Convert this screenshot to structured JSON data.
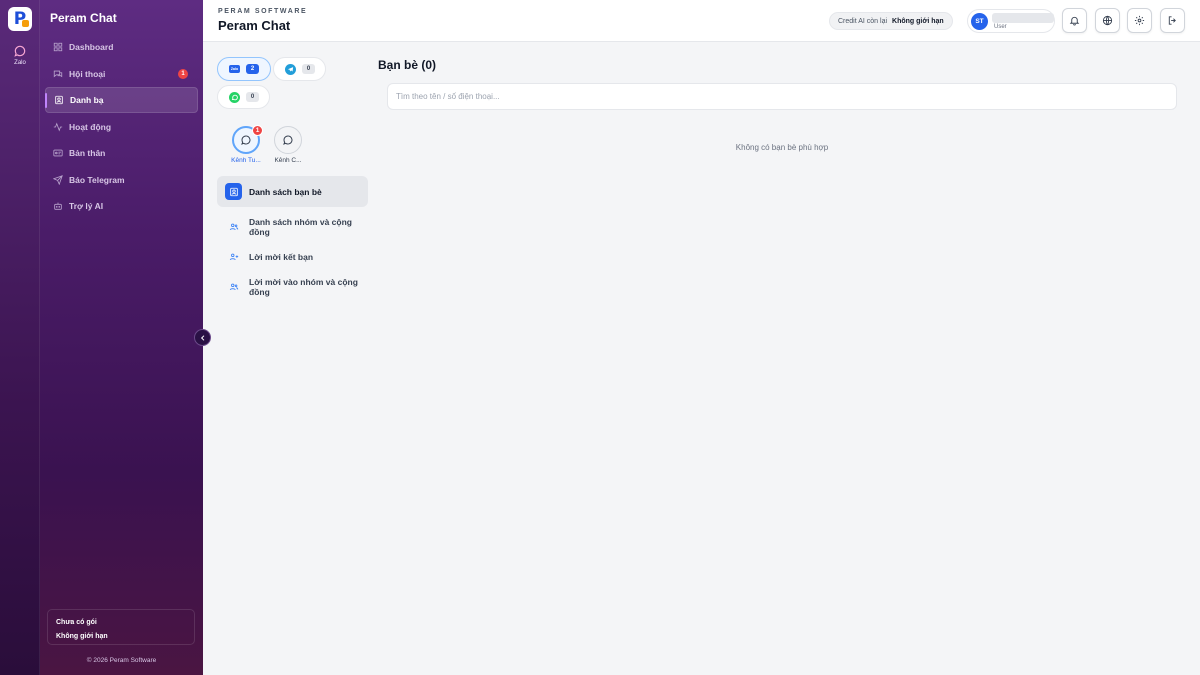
{
  "rail": {
    "logo_letter": "P",
    "items": [
      {
        "label": "Zalo",
        "icon": "chat-bubble-icon"
      }
    ]
  },
  "sidebar": {
    "brand": "Peram Chat",
    "nav": [
      {
        "label": "Dashboard",
        "icon": "grid-icon",
        "active": false
      },
      {
        "label": "Hội thoại",
        "icon": "chat-icon",
        "active": false,
        "badge": "1"
      },
      {
        "label": "Danh bạ",
        "icon": "contacts-icon",
        "active": true
      },
      {
        "label": "Hoạt động",
        "icon": "activity-icon",
        "active": false
      },
      {
        "label": "Bản thân",
        "icon": "id-card-icon",
        "active": false
      },
      {
        "label": "Báo Telegram",
        "icon": "send-icon",
        "active": false
      },
      {
        "label": "Trợ lý AI",
        "icon": "bot-icon",
        "active": false
      }
    ],
    "plan": {
      "line1": "Chưa có gói",
      "line2": "Không giới hạn"
    },
    "copyright": "© 2026 Peram Software"
  },
  "header": {
    "company": "PERAM SOFTWARE",
    "title": "Peram Chat",
    "credit_label": "Credit AI còn lại",
    "credit_value": "Không giới hạn",
    "user": {
      "initials": "ST",
      "role": "User"
    },
    "buttons": [
      "bell-icon",
      "globe-icon",
      "gear-icon",
      "logout-icon"
    ]
  },
  "channels": [
    {
      "name": "Zalo",
      "logo_text": "Zalo",
      "count": "2",
      "selected": true
    },
    {
      "name": "Telegram",
      "count": "0",
      "selected": false
    },
    {
      "name": "WhatsApp",
      "count": "0",
      "selected": false
    }
  ],
  "accounts": [
    {
      "name": "Kênh Tu...",
      "badge": "1",
      "selected": true
    },
    {
      "name": "Kênh C...",
      "badge": "",
      "selected": false
    }
  ],
  "menu": [
    {
      "label": "Danh sách bạn bè",
      "icon": "contact-card-icon",
      "active": true
    },
    {
      "label": "Danh sách nhóm và cộng đồng",
      "icon": "users-icon",
      "active": false
    },
    {
      "label": "Lời mời kết bạn",
      "icon": "user-plus-icon",
      "active": false
    },
    {
      "label": "Lời mời vào nhóm và cộng đồng",
      "icon": "users-icon",
      "active": false
    }
  ],
  "main": {
    "title": "Bạn bè (0)",
    "search_placeholder": "Tìm theo tên / số điện thoại...",
    "search_value": "",
    "empty_text": "Không có bạn bè phù hợp"
  },
  "colors": {
    "accent": "#2563eb",
    "sidebar_bg": "#4a1c68",
    "badge": "#ef4444"
  }
}
